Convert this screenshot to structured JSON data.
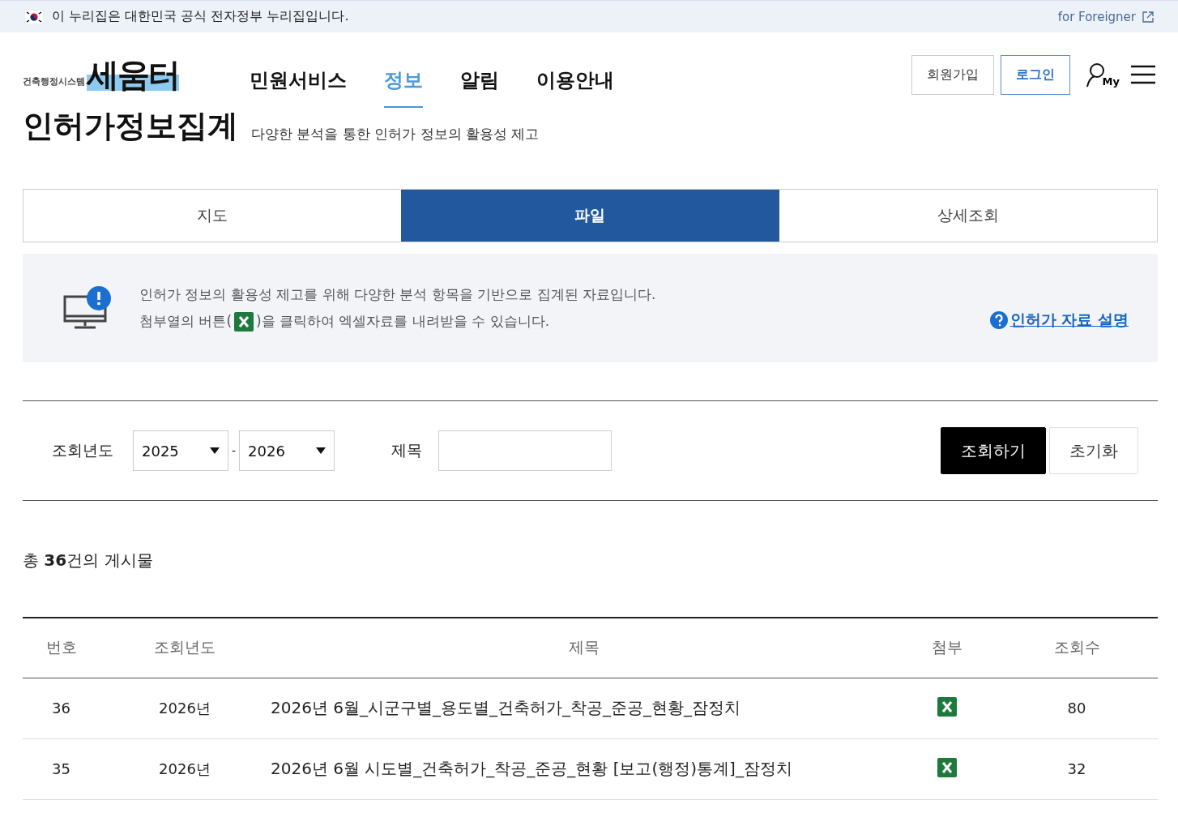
{
  "gov_banner": {
    "text": "이 누리집은 대한민국 공식 전자정부 누리집입니다.",
    "foreigner_link": "for Foreigner"
  },
  "header": {
    "logo": {
      "name": "세움터",
      "subtitle": "건축행정시스템"
    },
    "nav": [
      {
        "label": "민원서비스",
        "selected": false
      },
      {
        "label": "정보",
        "selected": true
      },
      {
        "label": "알림",
        "selected": false
      },
      {
        "label": "이용안내",
        "selected": false
      }
    ],
    "join_button": "회원가입",
    "login_button": "로그인",
    "my_label": "My"
  },
  "page": {
    "title": "인허가정보집계",
    "subtitle": "다양한 분석을 통한 인허가 정보의 활용성 제고"
  },
  "tabs": [
    {
      "label": "지도",
      "selected": false
    },
    {
      "label": "파일",
      "selected": true
    },
    {
      "label": "상세조회",
      "selected": false
    }
  ],
  "notice": {
    "line_1": "인허가 정보의 활용성 제고를 위해 다양한 분석 항목을 기반으로 집계된 자료입니다.",
    "line_2_before": "첨부열의 버튼(",
    "line_2_after": ")을 클릭하여 엑셀자료를 내려받을 수 있습니다.",
    "help_link": "인허가 자료 설명"
  },
  "search": {
    "year_label": "조회년도",
    "year_from": "2025",
    "separator": "-",
    "year_to": "2026",
    "title_label": "제목",
    "search_button": "조회하기",
    "reset_button": "초기화"
  },
  "total": "총 **36**건의 게시물",
  "table": {
    "columns": [
      "번호",
      "조회년도",
      "제목",
      "첨부",
      "조회수"
    ],
    "rows": [
      {
        "no": "36",
        "year": "2026년",
        "title": "2026년 6월_시군구별_용도별_건축허가_착공_준공_현황_잠정치",
        "views": "80"
      },
      {
        "no": "35",
        "year": "2026년",
        "title": "2026년 6월 시도별_건축허가_착공_준공_현황 [보고(행정)통계]_잠정치",
        "views": "32"
      }
    ]
  }
}
